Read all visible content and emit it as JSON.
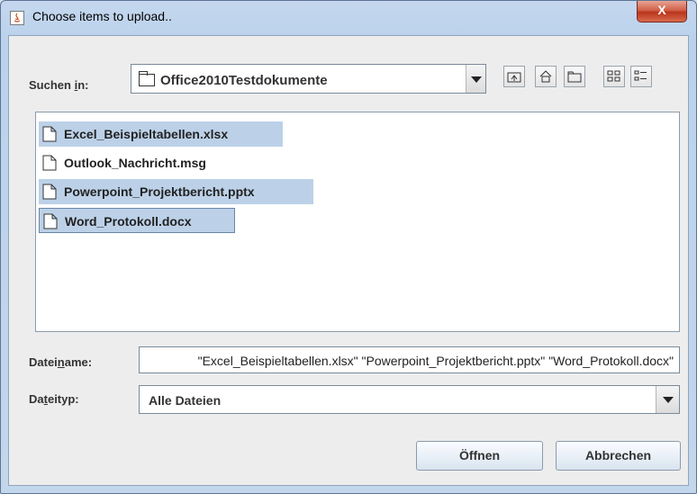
{
  "window": {
    "title": "Choose items to upload..",
    "close_label": "X"
  },
  "look_in": {
    "label_pre": "Suchen ",
    "label_mnemonic": "i",
    "label_post": "n:",
    "value": "Office2010Testdokumente"
  },
  "toolbar": {
    "buttons": [
      "up-one-level",
      "home",
      "new-folder",
      "list-view",
      "details-view"
    ]
  },
  "files": [
    {
      "name": "Excel_Beispieltabellen.xlsx",
      "selected": true,
      "focused": false
    },
    {
      "name": "Outlook_Nachricht.msg",
      "selected": false,
      "focused": false
    },
    {
      "name": "Powerpoint_Projektbericht.pptx",
      "selected": true,
      "focused": false
    },
    {
      "name": "Word_Protokoll.docx",
      "selected": true,
      "focused": true
    }
  ],
  "filename": {
    "label_pre": "Datei",
    "label_mnemonic": "n",
    "label_post": "ame:",
    "value": "\"Excel_Beispieltabellen.xlsx\" \"Powerpoint_Projektbericht.pptx\" \"Word_Protokoll.docx\""
  },
  "filetype": {
    "label_pre": "Da",
    "label_mnemonic": "t",
    "label_post": "eityp:",
    "value": "Alle Dateien"
  },
  "buttons": {
    "open": "Öffnen",
    "cancel": "Abbrechen"
  },
  "colors": {
    "selection": "#bcd1e8",
    "focus_border": "#6a86a8",
    "close_red": "#c24a2f"
  }
}
